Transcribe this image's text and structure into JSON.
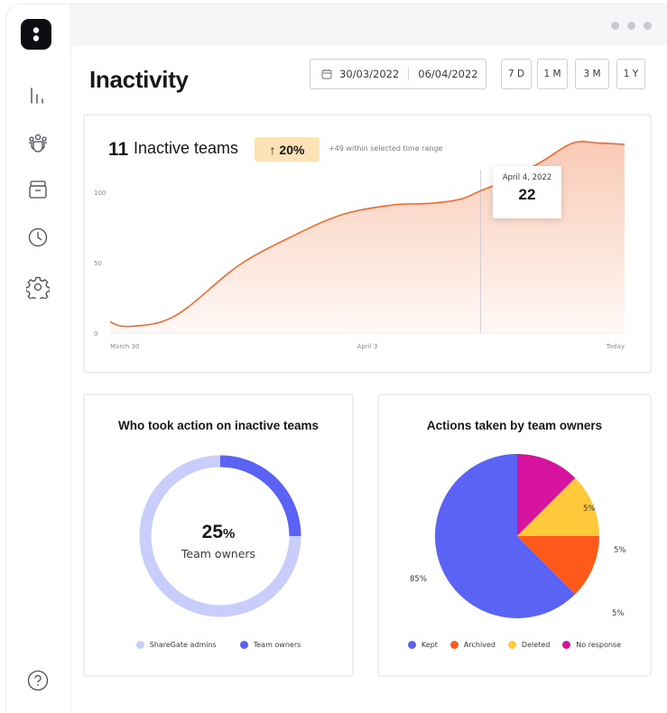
{
  "header": {
    "title": "Inactivity",
    "date_start": "30/03/2022",
    "date_end": "06/04/2022",
    "ranges": [
      "7 D",
      "1 M",
      "3 M",
      "1 Y"
    ]
  },
  "sidebar": {
    "items": [
      {
        "icon": "bar-chart-icon"
      },
      {
        "icon": "teams-icon"
      },
      {
        "icon": "archive-icon"
      },
      {
        "icon": "clock-icon"
      },
      {
        "icon": "settings-icon"
      }
    ],
    "help_icon": "help-icon"
  },
  "summary": {
    "count": "11",
    "label": "Inactive teams",
    "change": "↑ 20%",
    "note": "+49 within selected time range"
  },
  "tooltip": {
    "date": "April 4, 2022",
    "value": "22"
  },
  "donut_card": {
    "title": "Who took action on inactive teams",
    "center_value": "25",
    "center_unit": "%",
    "center_label": "Team owners"
  },
  "pie_card": {
    "title": "Actions taken by team owners"
  },
  "colors": {
    "accent": "#5b63f5",
    "area": "#f9c7b2",
    "line": "#f26a2b",
    "donut_light": "#c9cdfb",
    "kept": "#5b63f5",
    "archived": "#ff5a1a",
    "deleted": "#ffc93a",
    "no_response": "#d6139e"
  },
  "chart_data": [
    {
      "type": "area",
      "title": "",
      "x_tick_labels": [
        "March 30",
        "April 3",
        "Today"
      ],
      "y_tick_labels": [
        "0",
        "50",
        "100"
      ],
      "ylim": [
        0,
        100
      ],
      "grid": false,
      "series": [
        {
          "x": [
            0,
            0.02,
            0.05,
            0.1,
            0.15,
            0.25,
            0.35,
            0.45,
            0.55,
            0.62,
            0.68,
            0.72,
            0.78,
            0.84,
            0.9,
            0.95,
            1.0
          ],
          "values": [
            8,
            5,
            5,
            8,
            18,
            48,
            68,
            84,
            91,
            92,
            95,
            101,
            110,
            122,
            135,
            135,
            134
          ]
        }
      ]
    },
    {
      "type": "pie",
      "title": "Who took action on inactive teams",
      "donut": true,
      "categories": [
        "ShareGate admins",
        "Team owners"
      ],
      "values": [
        75,
        25
      ]
    },
    {
      "type": "pie",
      "title": "Actions taken by team owners",
      "categories": [
        "Kept",
        "Archived",
        "Deleted",
        "No response"
      ],
      "values": [
        85,
        5,
        5,
        5
      ],
      "labels": [
        "85%",
        "5%",
        "5%",
        "5%"
      ]
    }
  ]
}
